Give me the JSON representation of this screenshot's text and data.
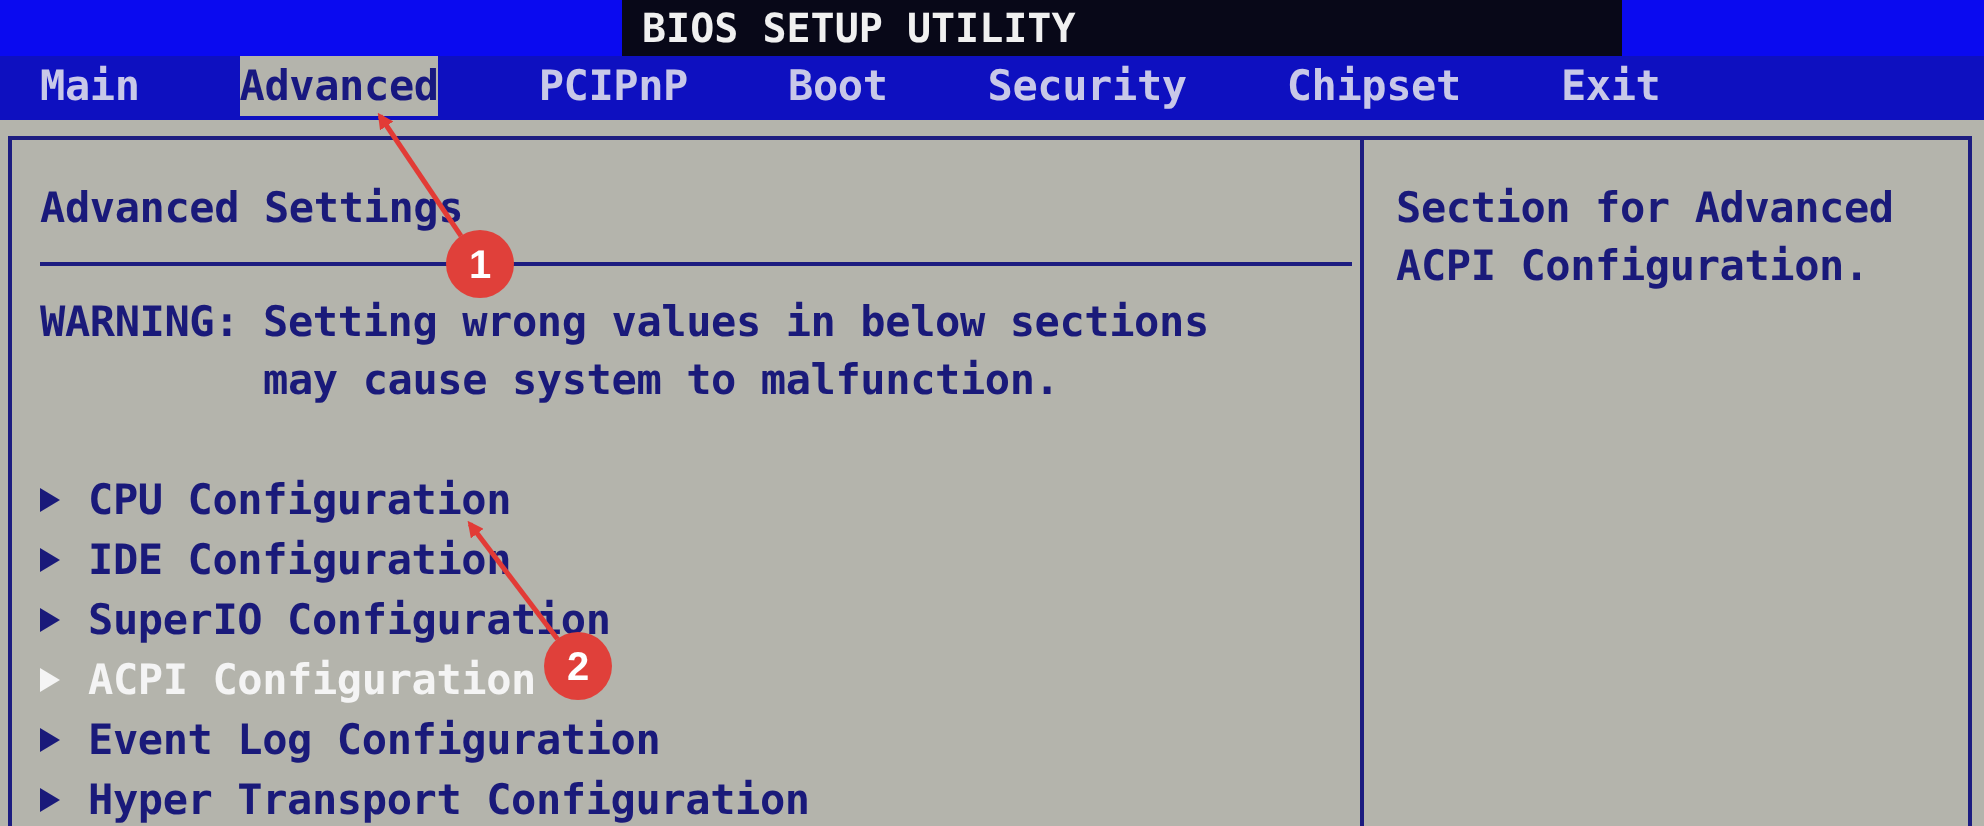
{
  "window": {
    "title": "BIOS SETUP UTILITY"
  },
  "tabs": [
    {
      "label": "Main",
      "selected": false
    },
    {
      "label": "Advanced",
      "selected": true
    },
    {
      "label": "PCIPnP",
      "selected": false
    },
    {
      "label": "Boot",
      "selected": false
    },
    {
      "label": "Security",
      "selected": false
    },
    {
      "label": "Chipset",
      "selected": false
    },
    {
      "label": "Exit",
      "selected": false
    }
  ],
  "main": {
    "heading": "Advanced Settings",
    "warning_label": "WARNING:",
    "warning_text": "Setting wrong values in below sections may cause system to malfunction.",
    "items": [
      {
        "label": "CPU Configuration",
        "selected": false
      },
      {
        "label": "IDE Configuration",
        "selected": false
      },
      {
        "label": "SuperIO Configuration",
        "selected": false
      },
      {
        "label": "ACPI Configuration",
        "selected": true
      },
      {
        "label": "Event Log Configuration",
        "selected": false
      },
      {
        "label": "Hyper Transport Configuration",
        "selected": false
      }
    ]
  },
  "help": {
    "text": "Section for Advanced ACPI Configuration."
  },
  "annotations": [
    {
      "label": "1"
    },
    {
      "label": "2"
    }
  ]
}
